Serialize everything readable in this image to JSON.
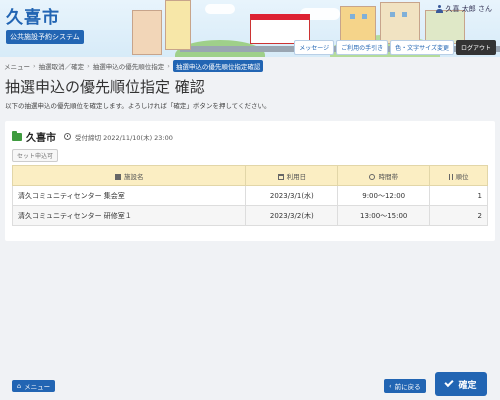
{
  "header": {
    "city_name": "久喜市",
    "system_name": "公共施設予約システム",
    "user_name": "久喜 太郎 さん",
    "buttons": [
      "メッセージ",
      "ご利用の手引き",
      "色・文字サイズ変更",
      "ログアウト"
    ]
  },
  "breadcrumb": [
    "メニュー",
    "抽選取消／確定",
    "抽選申込の優先順位指定",
    "抽選申込の優先順位指定確認"
  ],
  "page": {
    "title": "抽選申込の優先順位指定 確認",
    "lead": "以下の抽選申込の優先順位を確定します。よろしければ「確定」ボタンを押してください。"
  },
  "card": {
    "facility": "久喜市",
    "deadline": "受付締切 2022/11/10(木) 23:00",
    "set_label": "セット申込可"
  },
  "table": {
    "headers": [
      "施設名",
      "利用日",
      "時間帯",
      "順位"
    ],
    "rows": [
      [
        "清久コミュニティセンター 集会室",
        "2023/3/1(水)",
        "9:00～12:00",
        "1"
      ],
      [
        "清久コミュニティセンター 研修室１",
        "2023/3/2(木)",
        "13:00～15:00",
        "2"
      ]
    ]
  },
  "footer": {
    "menu": "メニュー",
    "back": "前に戻る",
    "confirm": "確定"
  }
}
